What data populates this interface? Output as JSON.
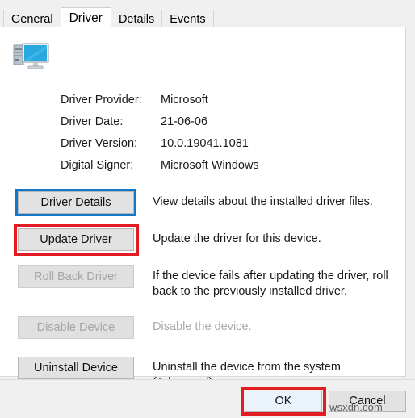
{
  "tabs": [
    {
      "label": "General",
      "active": false
    },
    {
      "label": "Driver",
      "active": true
    },
    {
      "label": "Details",
      "active": false
    },
    {
      "label": "Events",
      "active": false
    }
  ],
  "device_icon": "computer-desktop-icon",
  "info_rows": [
    {
      "label": "Driver Provider:",
      "value": "Microsoft"
    },
    {
      "label": "Driver Date:",
      "value": "21-06-06"
    },
    {
      "label": "Driver Version:",
      "value": "10.0.19041.1081"
    },
    {
      "label": "Digital Signer:",
      "value": "Microsoft Windows"
    }
  ],
  "actions": [
    {
      "button": "Driver Details",
      "description": "View details about the installed driver files.",
      "disabled": false,
      "highlight": "blue-focus"
    },
    {
      "button": "Update Driver",
      "description": "Update the driver for this device.",
      "disabled": false,
      "highlight": "red-annotation"
    },
    {
      "button": "Roll Back Driver",
      "description": "If the device fails after updating the driver, roll back to the previously installed driver.",
      "disabled": true,
      "highlight": "none"
    },
    {
      "button": "Disable Device",
      "description": "Disable the device.",
      "disabled": true,
      "highlight": "none"
    },
    {
      "button": "Uninstall Device",
      "description": "Uninstall the device from the system (Advanced).",
      "disabled": false,
      "highlight": "none"
    }
  ],
  "footer": {
    "ok_label": "OK",
    "cancel_label": "Cancel",
    "ok_highlight": "red-annotation"
  },
  "watermark": "wsxdn.com",
  "colors": {
    "focus_blue": "#1277c9",
    "annotation_red": "#e31b23",
    "dialog_bg": "#f0f0f0",
    "panel_bg": "#ffffff",
    "button_bg": "#e2e2e2",
    "disabled_text": "#a6a6a6",
    "default_button_bg": "#eaf2fb"
  }
}
